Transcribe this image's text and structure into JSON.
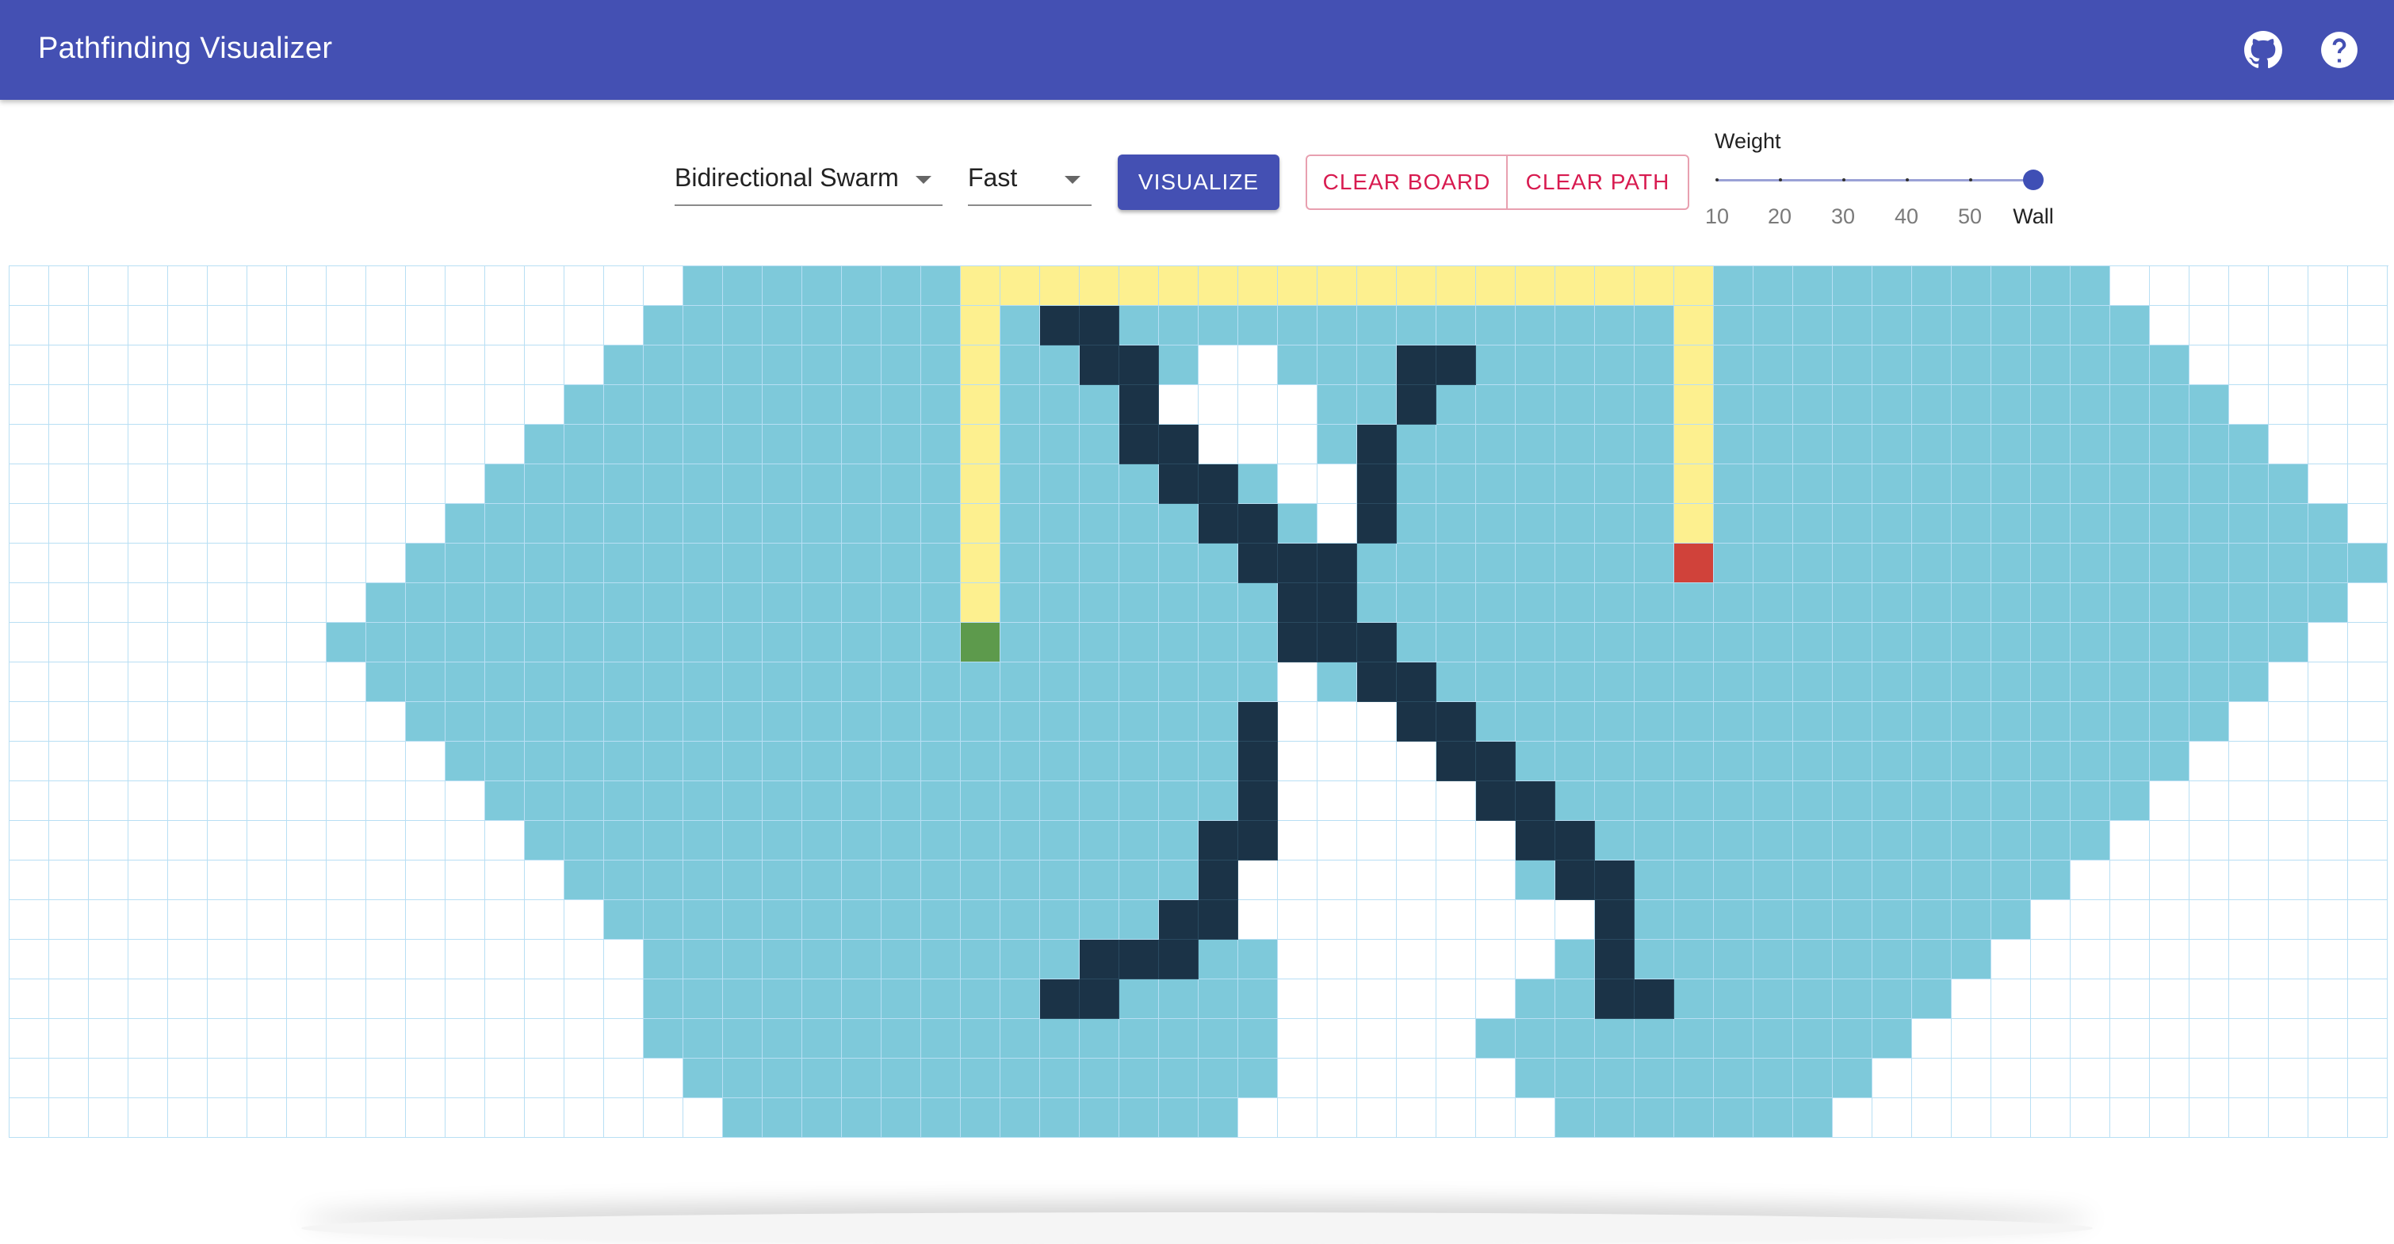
{
  "app": {
    "title": "Pathfinding Visualizer",
    "icons": [
      "github-icon",
      "help-icon"
    ],
    "colors": {
      "primary": "#4450b3",
      "secondary": "#d81b50"
    }
  },
  "controls": {
    "algorithm": {
      "selected": "Bidirectional Swarm"
    },
    "speed": {
      "selected": "Fast"
    },
    "visualize_label": "VISUALIZE",
    "clear_board_label": "CLEAR BOARD",
    "clear_path_label": "CLEAR PATH",
    "weight": {
      "label": "Weight",
      "marks": [
        "10",
        "20",
        "30",
        "40",
        "50",
        "Wall"
      ],
      "selected": "Wall"
    }
  },
  "grid": {
    "columns": 60,
    "rows": 22,
    "colors": {
      "empty": "#ffffff",
      "visited": "#7ec9da",
      "path": "#fdf08f",
      "wall": "#1b3347",
      "start": "#5d9a4c",
      "target": "#d0423a"
    },
    "start_cell": [
      9,
      24
    ],
    "target_cell": [
      7,
      42
    ],
    "visited_row_spans": [
      [
        17,
        52
      ],
      [
        16,
        53
      ],
      [
        15,
        54
      ],
      [
        14,
        55
      ],
      [
        13,
        56
      ],
      [
        12,
        57
      ],
      [
        11,
        58
      ],
      [
        10,
        59
      ],
      [
        9,
        58
      ],
      [
        8,
        57
      ],
      [
        9,
        56
      ],
      [
        10,
        55
      ],
      [
        11,
        54
      ],
      [
        12,
        53
      ],
      [
        13,
        52
      ],
      [
        14,
        51
      ],
      [
        15,
        50
      ],
      [
        16,
        49
      ],
      [
        16,
        48
      ],
      [
        16,
        47
      ],
      [
        17,
        46
      ],
      [
        18,
        45
      ]
    ],
    "empty_cells": [
      [
        2,
        30
      ],
      [
        2,
        31
      ],
      [
        3,
        29
      ],
      [
        3,
        30
      ],
      [
        3,
        31
      ],
      [
        3,
        32
      ],
      [
        4,
        30
      ],
      [
        4,
        31
      ],
      [
        4,
        32
      ],
      [
        5,
        32
      ],
      [
        5,
        33
      ],
      [
        6,
        33
      ],
      [
        10,
        32
      ],
      [
        11,
        32
      ],
      [
        11,
        33
      ],
      [
        11,
        34
      ],
      [
        12,
        32
      ],
      [
        12,
        33
      ],
      [
        12,
        34
      ],
      [
        12,
        35
      ],
      [
        13,
        32
      ],
      [
        13,
        33
      ],
      [
        13,
        34
      ],
      [
        13,
        35
      ],
      [
        13,
        36
      ],
      [
        14,
        32
      ],
      [
        14,
        33
      ],
      [
        14,
        34
      ],
      [
        14,
        35
      ],
      [
        14,
        36
      ],
      [
        14,
        37
      ],
      [
        15,
        31
      ],
      [
        15,
        32
      ],
      [
        15,
        33
      ],
      [
        15,
        34
      ],
      [
        15,
        35
      ],
      [
        15,
        36
      ],
      [
        15,
        37
      ],
      [
        16,
        31
      ],
      [
        16,
        32
      ],
      [
        16,
        33
      ],
      [
        16,
        34
      ],
      [
        16,
        35
      ],
      [
        16,
        36
      ],
      [
        16,
        37
      ],
      [
        16,
        38
      ],
      [
        16,
        39
      ],
      [
        17,
        32
      ],
      [
        17,
        33
      ],
      [
        17,
        34
      ],
      [
        17,
        35
      ],
      [
        17,
        36
      ],
      [
        17,
        37
      ],
      [
        17,
        38
      ],
      [
        18,
        32
      ],
      [
        18,
        33
      ],
      [
        18,
        34
      ],
      [
        18,
        35
      ],
      [
        18,
        36
      ],
      [
        18,
        37
      ],
      [
        19,
        32
      ],
      [
        19,
        33
      ],
      [
        19,
        34
      ],
      [
        19,
        35
      ],
      [
        19,
        36
      ],
      [
        20,
        32
      ],
      [
        20,
        33
      ],
      [
        20,
        34
      ],
      [
        20,
        35
      ],
      [
        20,
        36
      ],
      [
        20,
        37
      ],
      [
        21,
        31
      ],
      [
        21,
        32
      ],
      [
        21,
        33
      ],
      [
        21,
        34
      ],
      [
        21,
        35
      ],
      [
        21,
        36
      ],
      [
        21,
        37
      ],
      [
        21,
        38
      ]
    ],
    "wall_cells": [
      [
        1,
        26
      ],
      [
        1,
        27
      ],
      [
        2,
        27
      ],
      [
        2,
        28
      ],
      [
        2,
        35
      ],
      [
        2,
        36
      ],
      [
        3,
        28
      ],
      [
        3,
        35
      ],
      [
        4,
        28
      ],
      [
        4,
        29
      ],
      [
        4,
        34
      ],
      [
        5,
        29
      ],
      [
        5,
        30
      ],
      [
        5,
        34
      ],
      [
        6,
        30
      ],
      [
        6,
        31
      ],
      [
        6,
        34
      ],
      [
        7,
        31
      ],
      [
        7,
        32
      ],
      [
        7,
        33
      ],
      [
        8,
        32
      ],
      [
        8,
        33
      ],
      [
        9,
        32
      ],
      [
        9,
        33
      ],
      [
        9,
        34
      ],
      [
        10,
        34
      ],
      [
        10,
        35
      ],
      [
        11,
        31
      ],
      [
        11,
        35
      ],
      [
        11,
        36
      ],
      [
        12,
        31
      ],
      [
        12,
        36
      ],
      [
        12,
        37
      ],
      [
        13,
        31
      ],
      [
        13,
        37
      ],
      [
        13,
        38
      ],
      [
        14,
        30
      ],
      [
        14,
        31
      ],
      [
        14,
        38
      ],
      [
        14,
        39
      ],
      [
        15,
        30
      ],
      [
        15,
        39
      ],
      [
        15,
        40
      ],
      [
        16,
        29
      ],
      [
        16,
        30
      ],
      [
        16,
        40
      ],
      [
        17,
        27
      ],
      [
        17,
        28
      ],
      [
        17,
        29
      ],
      [
        17,
        40
      ],
      [
        18,
        26
      ],
      [
        18,
        27
      ],
      [
        18,
        40
      ],
      [
        18,
        41
      ]
    ],
    "path_cells": [
      [
        0,
        24
      ],
      [
        0,
        25
      ],
      [
        0,
        26
      ],
      [
        0,
        27
      ],
      [
        0,
        28
      ],
      [
        0,
        29
      ],
      [
        0,
        30
      ],
      [
        0,
        31
      ],
      [
        0,
        32
      ],
      [
        0,
        33
      ],
      [
        0,
        34
      ],
      [
        0,
        35
      ],
      [
        0,
        36
      ],
      [
        0,
        37
      ],
      [
        0,
        38
      ],
      [
        0,
        39
      ],
      [
        0,
        40
      ],
      [
        0,
        41
      ],
      [
        0,
        42
      ],
      [
        1,
        24
      ],
      [
        2,
        24
      ],
      [
        3,
        24
      ],
      [
        4,
        24
      ],
      [
        5,
        24
      ],
      [
        6,
        24
      ],
      [
        7,
        24
      ],
      [
        8,
        24
      ],
      [
        1,
        42
      ],
      [
        2,
        42
      ],
      [
        3,
        42
      ],
      [
        4,
        42
      ],
      [
        5,
        42
      ],
      [
        6,
        42
      ]
    ]
  }
}
